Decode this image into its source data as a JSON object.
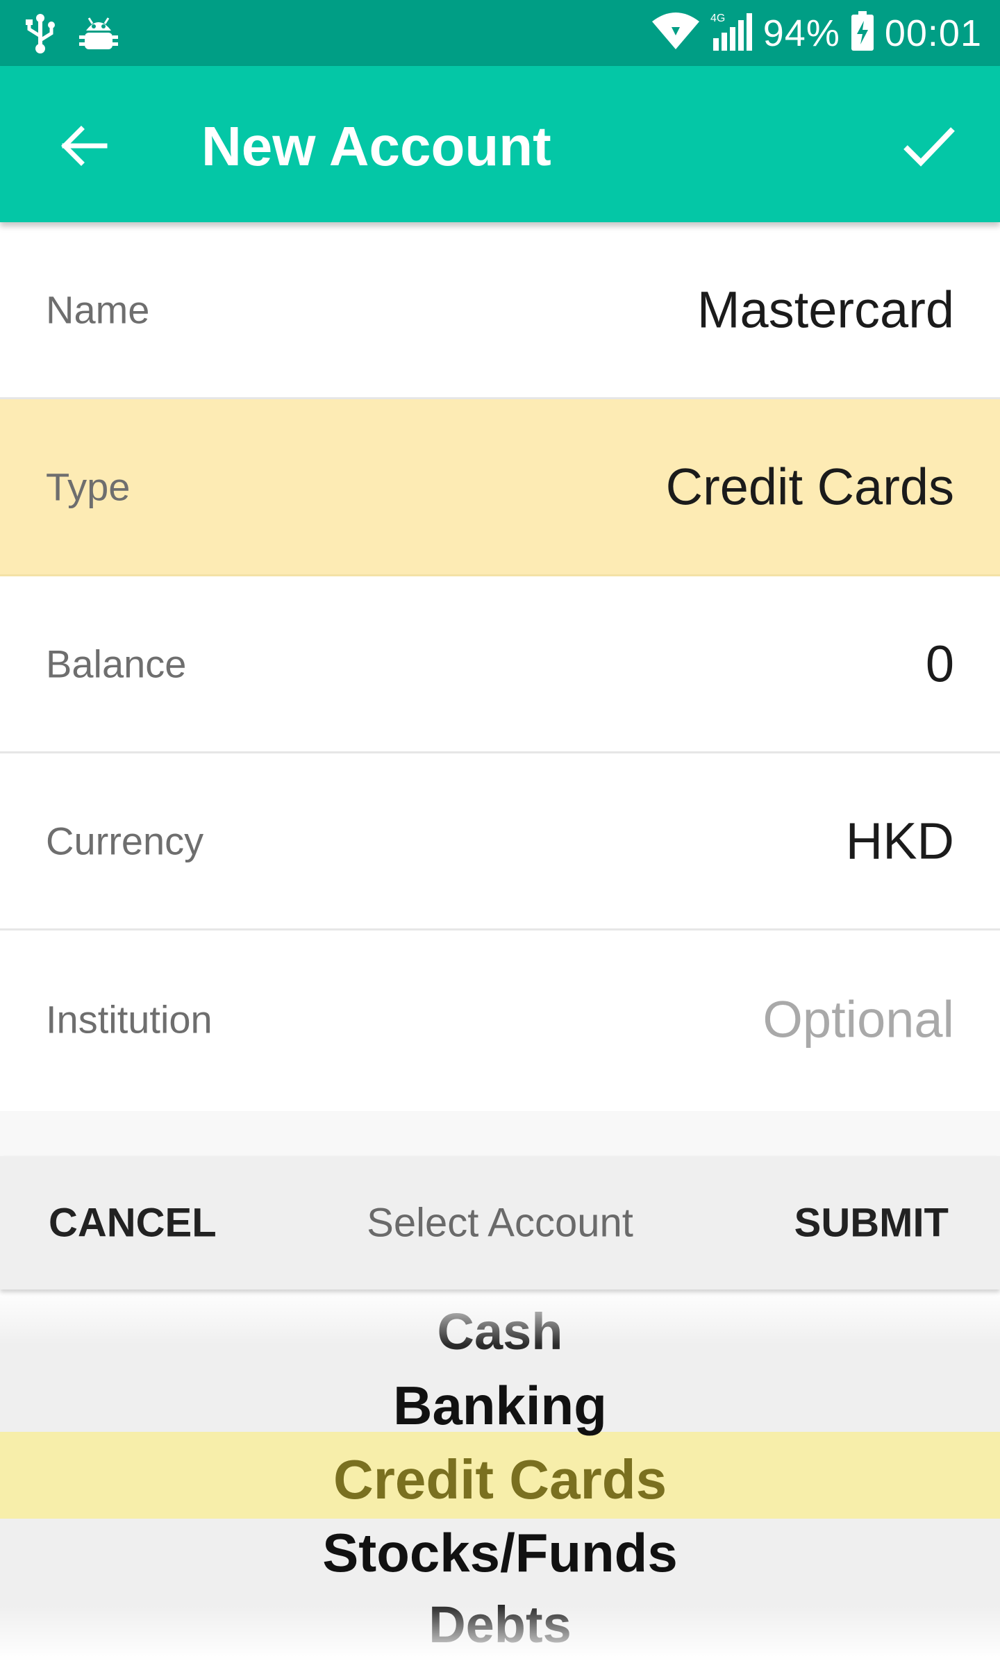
{
  "status_bar": {
    "battery_percent": "94%",
    "time": "00:01",
    "network": "4G",
    "icons": [
      "usb-icon",
      "android-debug-icon",
      "wifi-icon",
      "signal-icon",
      "battery-charging-icon"
    ]
  },
  "app_bar": {
    "title": "New Account",
    "back_icon": "arrow-left-icon",
    "confirm_icon": "check-icon",
    "color": "#04c7a6"
  },
  "form": {
    "name": {
      "label": "Name",
      "value": "Mastercard"
    },
    "type": {
      "label": "Type",
      "value": "Credit Cards"
    },
    "balance": {
      "label": "Balance",
      "value": "0"
    },
    "currency": {
      "label": "Currency",
      "value": "HKD"
    },
    "institution": {
      "label": "Institution",
      "placeholder": "Optional"
    }
  },
  "picker": {
    "cancel_label": "CANCEL",
    "title": "Select Account",
    "submit_label": "SUBMIT",
    "items": [
      "Cash",
      "Banking",
      "Credit Cards",
      "Stocks/Funds",
      "Debts"
    ],
    "selected": "Credit Cards",
    "highlight_color": "#f7eeaa"
  }
}
